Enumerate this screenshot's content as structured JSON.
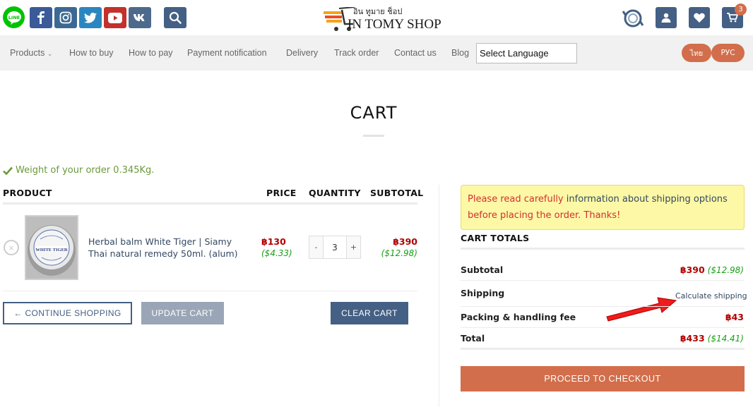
{
  "header": {
    "logo_thai": "อิน ทูมาย ช็อป",
    "logo_main": "IN TOMY SHOP",
    "cart_count": "3"
  },
  "nav": {
    "items": [
      "Products",
      "How to buy",
      "How to pay",
      "Payment notification",
      "Delivery",
      "Track order",
      "Contact us",
      "Blog"
    ],
    "language_select": "Select Language",
    "lang_th": "ไทย",
    "lang_ru": "РУС"
  },
  "page": {
    "title": "CART",
    "weight_notice": "Weight of your order 0.345Kg."
  },
  "cart_table": {
    "headers": {
      "product": "PRODUCT",
      "price": "PRICE",
      "quantity": "QUANTITY",
      "subtotal": "SUBTOTAL"
    },
    "items": [
      {
        "remove": "×",
        "name": "Herbal balm White Tiger | Siamy Thai natural remedy 50ml. (alum)",
        "thumb_label": "WHITE TIGER",
        "price_thb": "฿130",
        "price_usd": "($4.33)",
        "qty_minus": "-",
        "qty": "3",
        "qty_plus": "+",
        "subtotal_thb": "฿390",
        "subtotal_usd": "($12.98)"
      }
    ]
  },
  "buttons": {
    "continue": "← CONTINUE SHOPPING",
    "update": "UPDATE CART",
    "clear": "CLEAR CART",
    "checkout": "PROCEED TO CHECKOUT"
  },
  "notice": {
    "part1": "Please read carefully ",
    "link": "information about shipping options",
    "part2": " before placing the order. Thanks!"
  },
  "totals": {
    "title": "CART TOTALS",
    "subtotal_label": "Subtotal",
    "subtotal_thb": "฿390",
    "subtotal_usd": "($12.98)",
    "shipping_label": "Shipping",
    "calc_shipping": "Calculate shipping",
    "packing_label": "Packing & handling fee",
    "packing_thb": "฿43",
    "total_label": "Total",
    "total_thb": "฿433",
    "total_usd": "($14.41)"
  },
  "colors": {
    "primary": "#446084",
    "secondary": "#d26e4b",
    "price_red": "#b20000",
    "usd_green": "#18a018",
    "notice_bg": "#fdf8a5"
  }
}
